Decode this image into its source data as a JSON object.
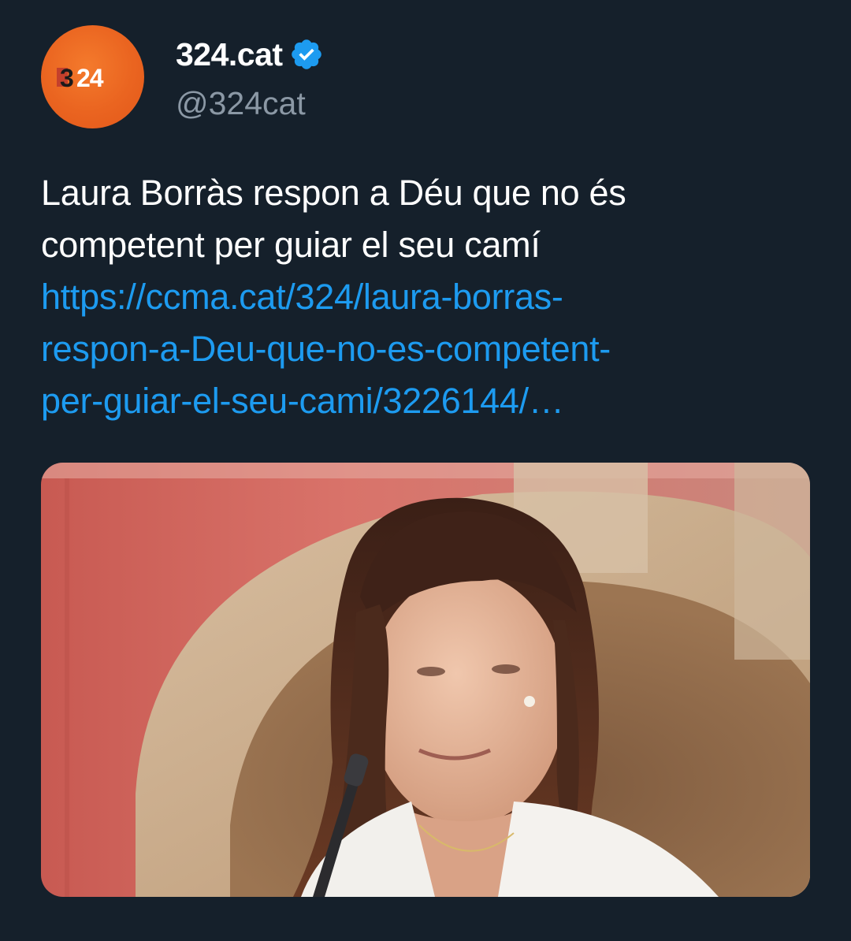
{
  "account": {
    "display_name": "324.cat",
    "handle": "@324cat",
    "verified": true,
    "avatar_logo_text": "324",
    "avatar_color": "#ea6420"
  },
  "tweet": {
    "text_lines": [
      "Laura Borràs respon a Déu que no és",
      "competent per guiar el seu camí"
    ],
    "link_lines": [
      "https://ccma.cat/324/laura-borras-",
      "respon-a-Deu-que-no-es-competent-",
      "per-guiar-el-seu-cami/3226144/…"
    ]
  },
  "colors": {
    "background": "#15202b",
    "link": "#1d9bf0",
    "verified_badge": "#1d9bf0",
    "secondary_text": "#8b98a5"
  },
  "icons": {
    "verified": "verified-badge-icon"
  }
}
